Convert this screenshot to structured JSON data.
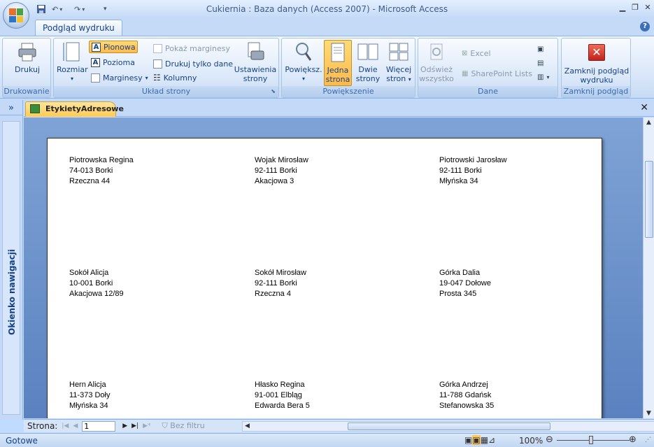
{
  "window": {
    "title": "Cukiernia : Baza danych (Access 2007) - Microsoft Access",
    "minimize_icon": "minimize-icon",
    "restore_icon": "restore-icon",
    "close_icon": "close-icon"
  },
  "ribbon": {
    "tab_label": "Podgląd wydruku",
    "groups": {
      "print": {
        "label": "Drukowanie",
        "print_button": "Drukuj"
      },
      "page_layout": {
        "label": "Układ strony",
        "size_button": "Rozmiar",
        "portrait": "Pionowa",
        "landscape": "Pozioma",
        "margins": "Marginesy",
        "show_margins": "Pokaż marginesy",
        "print_data_only": "Drukuj tylko dane",
        "columns": "Kolumny",
        "page_setup_line1": "Ustawienia",
        "page_setup_line2": "strony"
      },
      "zoom": {
        "label": "Powiększenie",
        "zoom_button": "Powiększ.",
        "one_page_line1": "Jedna",
        "one_page_line2": "strona",
        "two_pages_line1": "Dwie",
        "two_pages_line2": "strony",
        "more_pages_line1": "Więcej",
        "more_pages_line2": "stron"
      },
      "data": {
        "label": "Dane",
        "refresh_line1": "Odśwież",
        "refresh_line2": "wszystko",
        "excel": "Excel",
        "sharepoint": "SharePoint Lists"
      },
      "close_preview": {
        "label": "Zamknij podgląd",
        "button_line1": "Zamknij podgląd",
        "button_line2": "wydruku"
      }
    }
  },
  "nav_pane": {
    "label": "Okienko nawigacji"
  },
  "document_tab": {
    "title": "EtykietyAdresowe"
  },
  "labels": [
    {
      "name": "Piotrowska Regina",
      "city": "74-013 Borki",
      "street": "Rzeczna 44"
    },
    {
      "name": "Wojak Mirosław",
      "city": "92-111 Borki",
      "street": "Akacjowa 3"
    },
    {
      "name": "Piotrowski Jarosław",
      "city": "92-111 Borki",
      "street": "Młyńska 34"
    },
    {
      "name": "Sokół Alicja",
      "city": "10-001 Borki",
      "street": "Akacjowa 12/89"
    },
    {
      "name": "Sokół Mirosław",
      "city": "92-111 Borki",
      "street": "Rzeczna 4"
    },
    {
      "name": "Górka Dalia",
      "city": "19-047 Dołowe",
      "street": "Prosta 345"
    },
    {
      "name": "Hern Alicja",
      "city": "11-373 Doły",
      "street": "Młyńska 34"
    },
    {
      "name": "Hłasko Regina",
      "city": "91-001 Elbląg",
      "street": "Edwarda Bera 5"
    },
    {
      "name": "Górka Andrzej",
      "city": "11-788 Gdańsk",
      "street": "Stefanowska 35"
    }
  ],
  "record_nav": {
    "label": "Strona:",
    "page_value": "1",
    "filter": "Bez filtru"
  },
  "status": {
    "text": "Gotowe",
    "zoom": "100%"
  },
  "colors": {
    "ribbon_bg": "#dbe8f9",
    "active_button": "#ffc95c",
    "preview_bg": "#6b8fcb",
    "tab_accent": "#ffcb55"
  }
}
